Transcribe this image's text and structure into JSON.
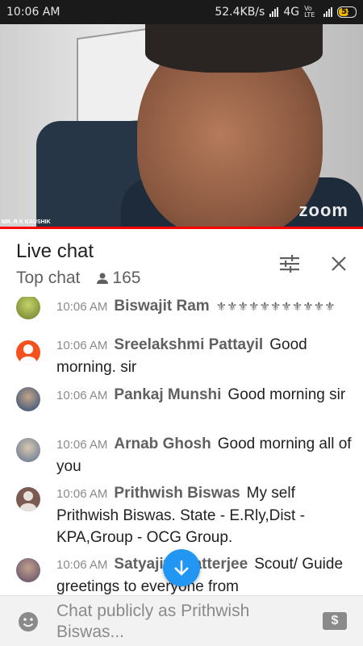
{
  "status_bar": {
    "time": "10:06 AM",
    "network_speed": "52.4KB/s",
    "network_type": "4G",
    "lte_label": "Vo LTE",
    "battery": "55"
  },
  "video": {
    "watermark": "zoom",
    "caption": "MR. R K KAUSHIK",
    "progress_percent": 100
  },
  "header": {
    "title": "Live chat",
    "mode": "Top chat",
    "viewer_count": "165",
    "icons": [
      "filter-settings-icon",
      "close-icon",
      "person-icon"
    ]
  },
  "chat": {
    "messages": [
      {
        "time": "10:06 AM",
        "author": "Biswajit Ram",
        "text": "⚜⚜⚜⚜⚜⚜⚜⚜⚜⚜⚜",
        "avatar_color": "#8a9a3a"
      },
      {
        "time": "10:06 AM",
        "author": "Sreelakshmi Pattayil",
        "text": "Good morning. sir",
        "avatar_color": "#f4511e"
      },
      {
        "time": "10:06 AM",
        "author": "Pankaj Munshi",
        "text": "Good morning sir",
        "avatar_color": "#3a5a8a"
      },
      {
        "time": "10:06 AM",
        "author": "Arnab Ghosh",
        "text": "Good morning all of you",
        "avatar_color": "#6d7f9a"
      },
      {
        "time": "10:06 AM",
        "author": "Prithwish Biswas",
        "text": "My self Prithwish Biswas. State - E.Rly,Dist - KPA,Group - OCG Group.",
        "avatar_color": "#7b5a52"
      },
      {
        "time": "10:06 AM",
        "author": "Satyajit Chatterjee",
        "text": "Scout/ Guide greetings to everyone from",
        "avatar_color": "#6a5a7a"
      }
    ]
  },
  "input": {
    "placeholder": "Chat publicly as Prithwish Biswas...",
    "icons": [
      "emoji-icon",
      "super-chat-icon",
      "scroll-down-icon"
    ]
  },
  "colors": {
    "accent": "#2196f3",
    "progress": "#ff0000",
    "status_bar": "#1a1a1a"
  }
}
